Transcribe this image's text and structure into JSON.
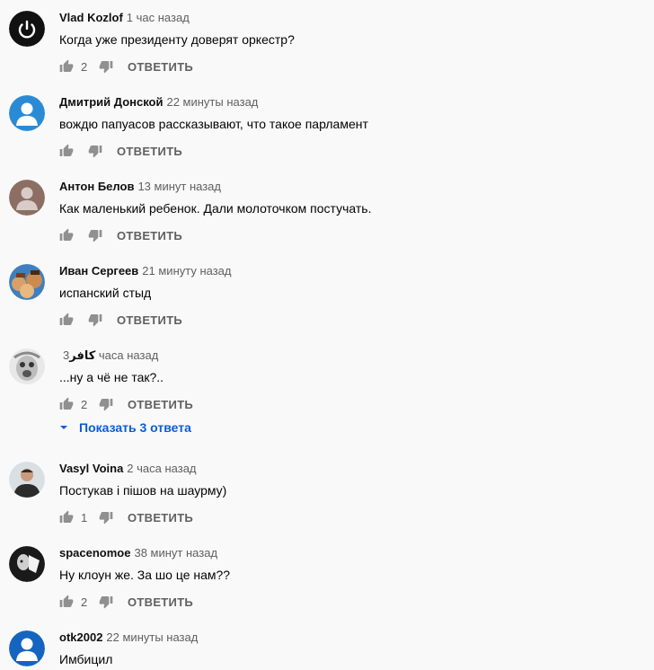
{
  "labels": {
    "reply": "ОТВЕТИТЬ",
    "show_replies": "Показать 3 ответа"
  },
  "comments": [
    {
      "author": "Vlad Kozlof",
      "time": "1 час назад",
      "text": "Когда уже президенту доверят оркестр?",
      "likes": "2"
    },
    {
      "author": "Дмитрий Донской",
      "time": "22 минуты назад",
      "text": "вождю папуасов рассказывают, что такое парламент",
      "likes": ""
    },
    {
      "author": "Антон Белов",
      "time": "13 минут назад",
      "text": "Как маленький ребенок. Дали молоточком постучать.",
      "likes": ""
    },
    {
      "author": "Иван Сергеев",
      "time": "21 минуту назад",
      "text": "испанский стыд",
      "likes": ""
    },
    {
      "author": "كافر",
      "time": "3 часа назад",
      "text": "...ну а чё не так?..",
      "likes": "2"
    },
    {
      "author": "Vasyl Voina",
      "time": "2 часа назад",
      "text": "Постукав і пішов на шаурму)",
      "likes": "1"
    },
    {
      "author": "spacenomoe",
      "time": "38 минут назад",
      "text": "Ну клоун же. За шо це нам??",
      "likes": "2"
    },
    {
      "author": "otk2002",
      "time": "22 минуты назад",
      "text": "Имбицил",
      "likes": ""
    }
  ],
  "colors": {
    "link_blue": "#065fd4",
    "secondary_text": "#606060"
  },
  "icons": [
    "power-icon",
    "thumb-up-icon",
    "thumb-down-icon",
    "chevron-down-icon"
  ]
}
